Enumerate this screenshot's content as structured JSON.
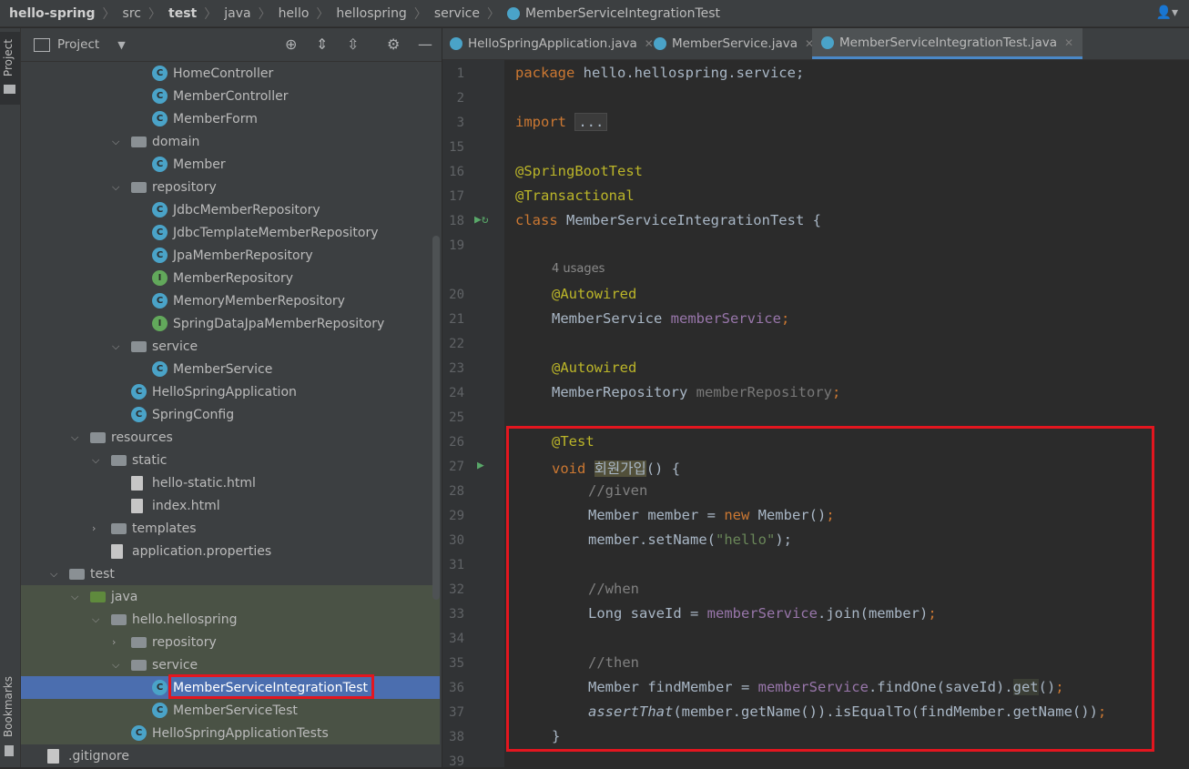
{
  "breadcrumb": {
    "items": [
      "hello-spring",
      "src",
      "test",
      "java",
      "hello",
      "hellospring",
      "service",
      "MemberServiceIntegrationTest"
    ]
  },
  "toolbar": {
    "user_icon": "user-icon"
  },
  "left_strip": {
    "project_tab": "Project",
    "bookmarks_tab": "Bookmarks"
  },
  "project_panel": {
    "title": "Project",
    "tree": [
      {
        "label": "HomeController",
        "icon": "class-icon"
      },
      {
        "label": "MemberController",
        "icon": "class-icon"
      },
      {
        "label": "MemberForm",
        "icon": "class-icon"
      },
      {
        "label": "domain",
        "icon": "package-icon",
        "expanded": true
      },
      {
        "label": "Member",
        "icon": "class-icon"
      },
      {
        "label": "repository",
        "icon": "package-icon",
        "expanded": true
      },
      {
        "label": "JdbcMemberRepository",
        "icon": "class-icon"
      },
      {
        "label": "JdbcTemplateMemberRepository",
        "icon": "class-icon"
      },
      {
        "label": "JpaMemberRepository",
        "icon": "class-icon"
      },
      {
        "label": "MemberRepository",
        "icon": "interface-icon"
      },
      {
        "label": "MemoryMemberRepository",
        "icon": "class-icon"
      },
      {
        "label": "SpringDataJpaMemberRepository",
        "icon": "interface-icon"
      },
      {
        "label": "service",
        "icon": "package-icon",
        "expanded": true
      },
      {
        "label": "MemberService",
        "icon": "class-icon"
      },
      {
        "label": "HelloSpringApplication",
        "icon": "class-icon"
      },
      {
        "label": "SpringConfig",
        "icon": "class-icon"
      },
      {
        "label": "resources",
        "icon": "folder-icon",
        "expanded": true
      },
      {
        "label": "static",
        "icon": "folder-icon",
        "expanded": true
      },
      {
        "label": "hello-static.html",
        "icon": "html-icon"
      },
      {
        "label": "index.html",
        "icon": "html-icon"
      },
      {
        "label": "templates",
        "icon": "folder-icon",
        "expanded": false
      },
      {
        "label": "application.properties",
        "icon": "properties-icon"
      },
      {
        "label": "test",
        "icon": "folder-icon",
        "expanded": true
      },
      {
        "label": "java",
        "icon": "source-folder-icon",
        "expanded": true
      },
      {
        "label": "hello.hellospring",
        "icon": "package-icon",
        "expanded": true
      },
      {
        "label": "repository",
        "icon": "package-icon",
        "expanded": false
      },
      {
        "label": "service",
        "icon": "package-icon",
        "expanded": true
      },
      {
        "label": "MemberServiceIntegrationTest",
        "icon": "class-icon",
        "selected": true
      },
      {
        "label": "MemberServiceTest",
        "icon": "class-icon"
      },
      {
        "label": "HelloSpringApplicationTests",
        "icon": "class-icon"
      },
      {
        "label": ".gitignore",
        "icon": "gitignore-icon"
      }
    ]
  },
  "editor": {
    "tabs": [
      {
        "label": "HelloSpringApplication.java",
        "active": false
      },
      {
        "label": "MemberService.java",
        "active": false
      },
      {
        "label": "MemberServiceIntegrationTest.java",
        "active": true
      }
    ],
    "line_numbers": [
      "1",
      "2",
      "3",
      "15",
      "16",
      "17",
      "18",
      "19",
      "20",
      "21",
      "22",
      "23",
      "24",
      "25",
      "26",
      "27",
      "28",
      "29",
      "30",
      "31",
      "32",
      "33",
      "34",
      "35",
      "36",
      "37",
      "38",
      "39"
    ],
    "usages_hint": "4 usages",
    "code": {
      "l1_kw": "package",
      "l1_rest": " hello.hellospring.service;",
      "l3_kw": "import",
      "l3_fold": "...",
      "l16": "@SpringBootTest",
      "l17": "@Transactional",
      "l18_kw": "class",
      "l18_rest": " MemberServiceIntegrationTest {",
      "l20": "@Autowired",
      "l21_type": "MemberService ",
      "l21_field": "memberService",
      "l21_end": ";",
      "l23": "@Autowired",
      "l24_type": "MemberRepository ",
      "l24_field": "memberRepository",
      "l24_end": ";",
      "l26": "@Test",
      "l27_kw": "void",
      "l27_name": "회원가입",
      "l27_rest": "() {",
      "l28": "//given",
      "l29_a": "Member member = ",
      "l29_kw": "new",
      "l29_b": " Member()",
      "l29_end": ";",
      "l30_a": "member.setName(",
      "l30_str": "\"hello\"",
      "l30_end": ");",
      "l32": "//when",
      "l33_a": "Long saveId = ",
      "l33_field": "memberService",
      "l33_b": ".join(member)",
      "l33_end": ";",
      "l35": "//then",
      "l36_a": "Member findMember = ",
      "l36_field": "memberService",
      "l36_b": ".findOne(saveId).",
      "l36_get": "get",
      "l36_c": "()",
      "l36_end": ";",
      "l37_italic": "assertThat",
      "l37_rest": "(member.getName()).isEqualTo(findMember.getName())",
      "l37_end": ";",
      "l38": "}"
    }
  },
  "colors": {
    "keyword": "#cc7832",
    "annotation": "#bbb529",
    "field": "#9876aa",
    "string": "#6a8759",
    "highlight": "#e3161f",
    "selection": "#4b6eaf"
  }
}
